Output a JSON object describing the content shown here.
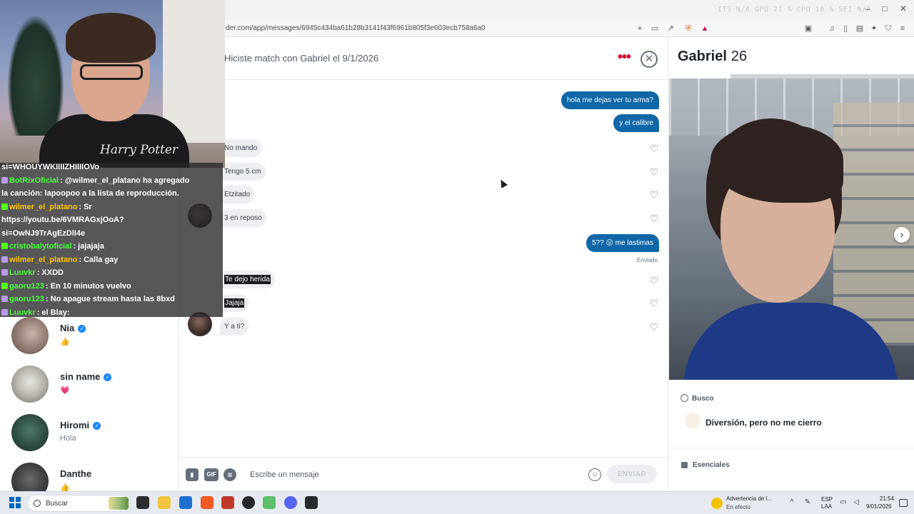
{
  "browser": {
    "url": "der.com/app/messages/6945c434ba61b28b3141f43f6961b805f3e603ecb758a6a0",
    "sys_stats": "ITS  N/A    GPU 21 %    CPU 18 %    SEI  N/A"
  },
  "sidebar": {
    "contacts": [
      {
        "name": "Nia",
        "verified": true,
        "message": "👍"
      },
      {
        "name": "sin name",
        "verified": true,
        "message": "💗"
      },
      {
        "name": "Hiromi",
        "verified": true,
        "message": "Hola"
      },
      {
        "name": "Danthe",
        "verified": false,
        "message": "👍"
      }
    ]
  },
  "webcam": {
    "shirt_text": "Harry Potter"
  },
  "stream_chat": [
    {
      "user": "",
      "text": "si=WHOUYWKIIIIZHIIIIOVo",
      "user_color": "#ffffff"
    },
    {
      "user": "BotRixOficial",
      "text": ": @wilmer_el_platano ha agregado",
      "user_color": "#49ff3b"
    },
    {
      "user": "",
      "text": "la canción: lapoopoo a la lista de reproducción.",
      "user_color": "#ffffff"
    },
    {
      "user": "wilmer_el_platano",
      "text": ": Sr",
      "user_color": "#ffc400"
    },
    {
      "user": "",
      "text": "https://youtu.be/6VMRAGxjOoA?",
      "user_color": "#ffffff"
    },
    {
      "user": "",
      "text": "si=OwNJ9TrAgEzDlI4e",
      "user_color": "#ffffff"
    },
    {
      "user": "cristobalytoficial",
      "text": ": jajajaja",
      "user_color": "#49ff3b"
    },
    {
      "user": "wilmer_el_platano",
      "text": ": Calla gay",
      "user_color": "#ffc400"
    },
    {
      "user": "Luuvkr",
      "text": ": XXDD",
      "user_color": "#49ff3b"
    },
    {
      "user": "gaoru123",
      "text": ": En 10 minutos vuelvo",
      "user_color": "#49ff3b"
    },
    {
      "user": "gaoru123",
      "text": ": No apague stream hasta las 8bxd",
      "user_color": "#49ff3b"
    },
    {
      "user": "Luuvkr",
      "text": ": el Blay:",
      "user_color": "#49ff3b"
    }
  ],
  "chat": {
    "match_text": "Hiciste match con Gabriel el 9/1/2026",
    "more_icon": "•••",
    "close_icon": "✕",
    "sent_status": "Enviado",
    "messages_out": [
      {
        "text": "hola me dejas ver tu arma?"
      },
      {
        "text": "y el calibre"
      },
      {
        "text": "5?? 😮 me lastimas"
      }
    ],
    "messages_in": [
      {
        "text": "No mando"
      },
      {
        "text": "Tengo 5 cm"
      },
      {
        "text": "Etzitado"
      },
      {
        "text": "3 en reposo"
      },
      {
        "text": "Te dejo herida"
      },
      {
        "text": "Jajaja"
      },
      {
        "text": "Y a ti?"
      }
    ],
    "composer": {
      "placeholder": "Escribe un mensaje",
      "gif_label": "GIF",
      "send_label": "ENVIAR"
    }
  },
  "profile": {
    "name": "Gabriel",
    "age": "26",
    "photo_progress": 0.25,
    "looking_for_label": "Busco",
    "looking_for_value": "Diversión, pero no me cierro",
    "essentials_label": "Esenciales"
  },
  "taskbar": {
    "search_label": "Buscar",
    "alert_title": "Advertencia de l...",
    "alert_sub": "En efecto",
    "lang_1": "ESP",
    "lang_2": "LAA",
    "time": "21:54",
    "date": "9/01/2026"
  },
  "colors": {
    "outgoing_bubble": "#1067a7",
    "incoming_bubble": "#eceef2",
    "accent": "#d6002f"
  }
}
